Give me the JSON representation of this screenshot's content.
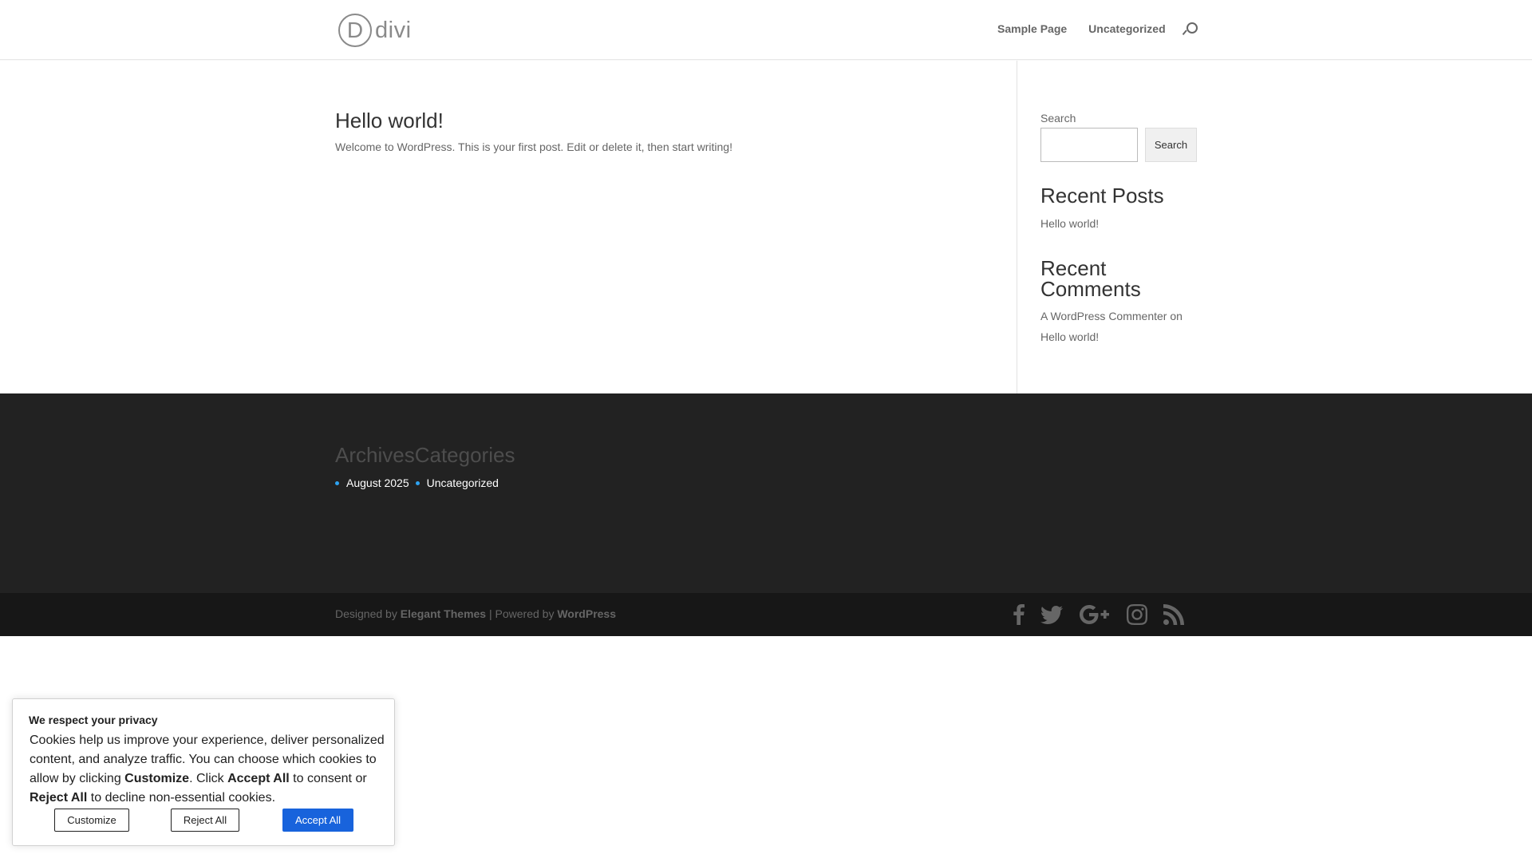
{
  "header": {
    "logo_letter": "D",
    "logo_text": "divi",
    "nav": [
      {
        "label": "Sample Page"
      },
      {
        "label": "Uncategorized"
      }
    ]
  },
  "post": {
    "title": "Hello world!",
    "excerpt": "Welcome to WordPress. This is your first post. Edit or delete it, then start writing!"
  },
  "sidebar": {
    "search_label": "Search",
    "search_value": "",
    "search_button": "Search",
    "recent_posts_title": "Recent Posts",
    "recent_posts": [
      "Hello world!"
    ],
    "recent_comments_title": "Recent Comments",
    "comment_author": "A WordPress Commenter",
    "comment_on": " on ",
    "comment_post": "Hello world!"
  },
  "footer": {
    "archives_title": "Archives",
    "categories_title": "Categories",
    "archives": [
      "August 2025"
    ],
    "categories": [
      "Uncategorized"
    ]
  },
  "bottom_bar": {
    "designed_by": "Designed by ",
    "elegant_themes": "Elegant Themes",
    "powered_by": " | Powered by ",
    "wordpress": "WordPress",
    "social_icons": [
      "facebook-icon",
      "twitter-icon",
      "google-plus-icon",
      "instagram-icon",
      "rss-icon"
    ]
  },
  "cookie_banner": {
    "title": "We respect your privacy",
    "text_1": "Cookies help us improve your experience, deliver personalized content, and analyze traffic. You can choose which cookies to allow by clicking ",
    "customize_word": "Customize",
    "text_2": ". Click ",
    "accept_all_word": "Accept All",
    "text_3": " to consent or ",
    "reject_all_word": "Reject All",
    "text_4": " to decline non-essential cookies.",
    "customize_button": "Customize",
    "reject_button": "Reject All",
    "accept_button": "Accept All"
  },
  "colors": {
    "accent": "#2ea3f2",
    "accept_button": "#1863dc",
    "footer_bg": "#222222",
    "bottom_bar_bg": "#171717"
  }
}
